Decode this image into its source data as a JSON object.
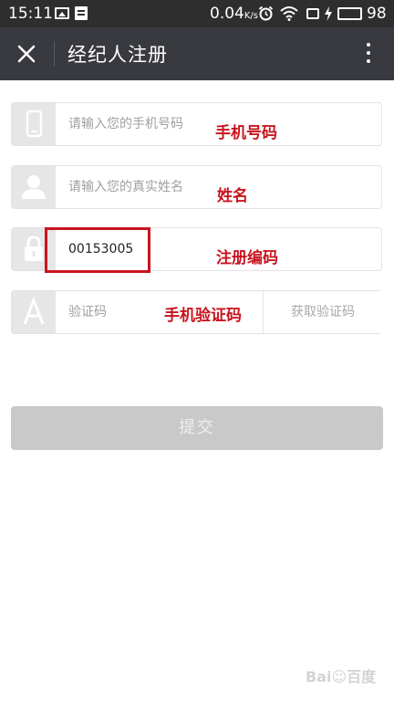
{
  "status_bar": {
    "time": "15:11",
    "net_speed": "0.04",
    "net_speed_unit": "K/s",
    "battery_level": "98",
    "battery_color": "#4cd964"
  },
  "title_bar": {
    "title": "经纪人注册",
    "close_icon": "close-icon",
    "more_icon": "more-vertical-icon"
  },
  "form": {
    "phone": {
      "icon": "phone-icon",
      "placeholder": "请输入您的手机号码",
      "value": "",
      "annotation": "手机号码"
    },
    "name": {
      "icon": "user-icon",
      "placeholder": "请输入您的真实姓名",
      "value": "",
      "annotation": "姓名"
    },
    "reg_code": {
      "icon": "lock-icon",
      "placeholder": "",
      "value": "00153005",
      "annotation": "注册编码"
    },
    "sms_code": {
      "icon": "letter-a-icon",
      "placeholder": "验证码",
      "value": "",
      "annotation": "手机验证码",
      "get_code_label": "获取验证码"
    },
    "submit_label": "提交"
  },
  "colors": {
    "title_bar": "#393a3f",
    "annotation": "#c8141e",
    "submit_disabled": "#c9c9c9"
  }
}
